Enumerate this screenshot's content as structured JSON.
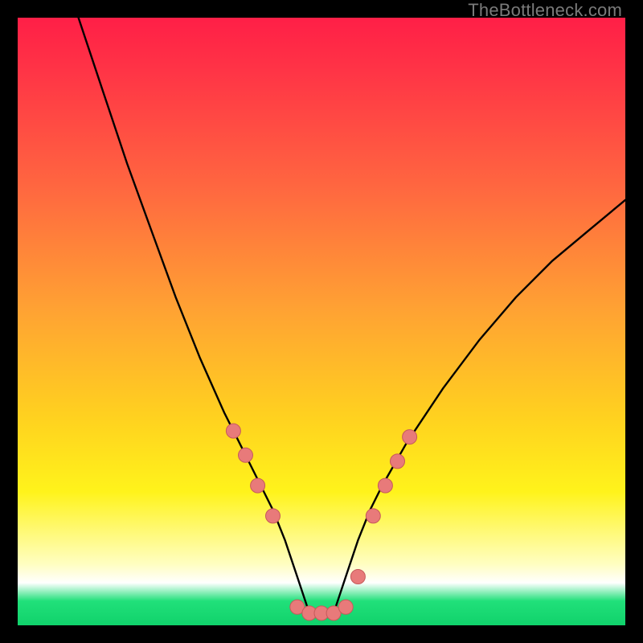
{
  "watermark": "TheBottleneck.com",
  "colors": {
    "frame": "#000000",
    "curve": "#000000",
    "marker_fill": "#e87a7a",
    "marker_stroke": "#c65a5a",
    "gradient_top": "#ff1f47",
    "gradient_mid": "#ffd21f",
    "gradient_bottom": "#10d26b"
  },
  "chart_data": {
    "type": "line",
    "title": "",
    "xlabel": "",
    "ylabel": "",
    "xlim": [
      0,
      100
    ],
    "ylim": [
      0,
      100
    ],
    "grid": false,
    "legend": false,
    "series": [
      {
        "name": "bottleneck-curve",
        "x": [
          10,
          14,
          18,
          22,
          26,
          30,
          34,
          36,
          38,
          40,
          42,
          44,
          46,
          48,
          50,
          52,
          54,
          56,
          58,
          60,
          64,
          70,
          76,
          82,
          88,
          94,
          100
        ],
        "values": [
          100,
          88,
          76,
          65,
          54,
          44,
          35,
          31,
          27,
          23,
          19,
          14,
          8,
          2,
          2,
          2,
          8,
          14,
          19,
          23,
          30,
          39,
          47,
          54,
          60,
          65,
          70
        ]
      }
    ],
    "markers": {
      "name": "highlighted-points",
      "x": [
        35.5,
        37.5,
        39.5,
        42.0,
        46.0,
        48.0,
        50.0,
        52.0,
        54.0,
        56.0,
        58.5,
        60.5,
        62.5,
        64.5
      ],
      "values": [
        32,
        28,
        23,
        18,
        3,
        2,
        2,
        2,
        3,
        8,
        18,
        23,
        27,
        31
      ]
    }
  }
}
